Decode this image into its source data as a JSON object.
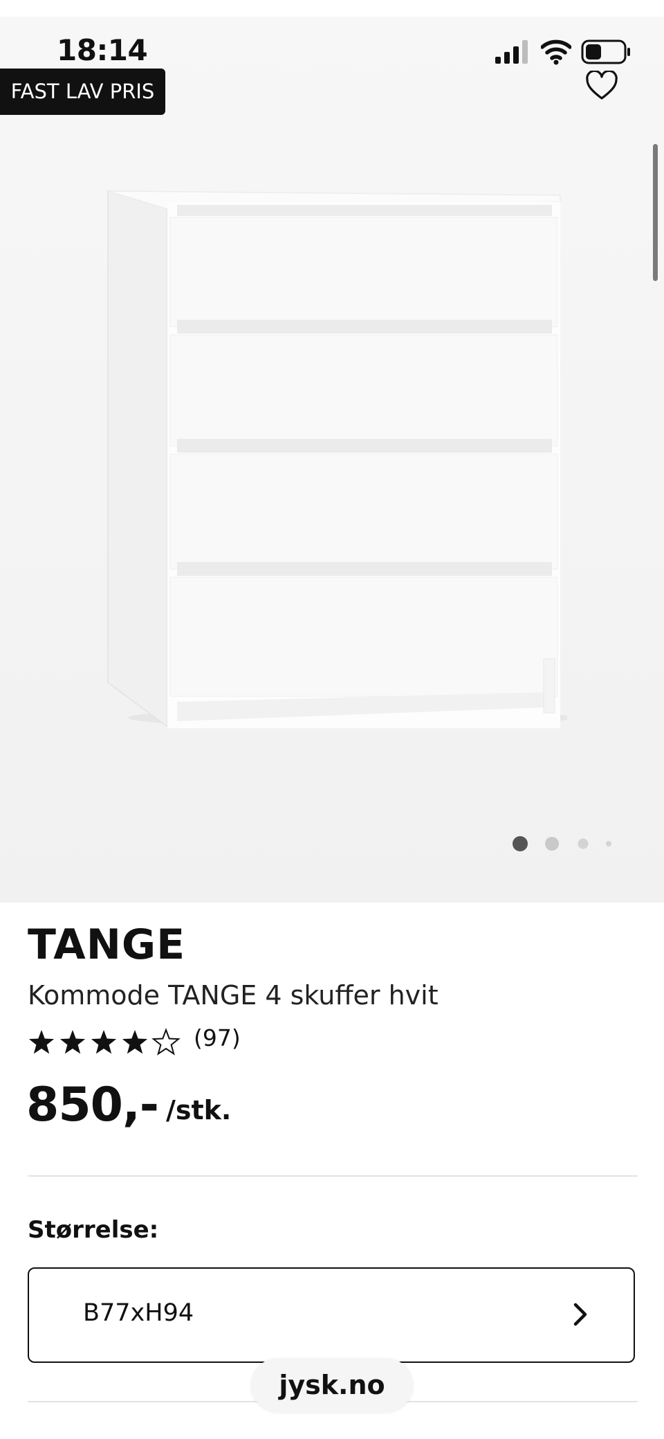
{
  "status_bar": {
    "time": "18:14"
  },
  "badge": {
    "label": "FAST LAV PRIS"
  },
  "gallery": {
    "total_images": 4,
    "active_index": 0
  },
  "product": {
    "brand": "TANGE",
    "name": "Kommode TANGE 4 skuffer hvit",
    "rating": 4,
    "rating_max": 5,
    "review_count": "(97)",
    "price": "850,-",
    "price_unit": "/stk."
  },
  "size": {
    "label": "Størrelse:",
    "value": "B77xH94"
  },
  "browser": {
    "url": "jysk.no"
  },
  "icons": {
    "favorite": "heart-outline-icon",
    "select_arrow": "chevron-right-icon",
    "signal": "cellular-signal-icon",
    "wifi": "wifi-icon",
    "battery": "battery-icon"
  },
  "colors": {
    "badge_bg": "#111111",
    "text": "#111111",
    "hero_bg": "#f3f3f3"
  }
}
